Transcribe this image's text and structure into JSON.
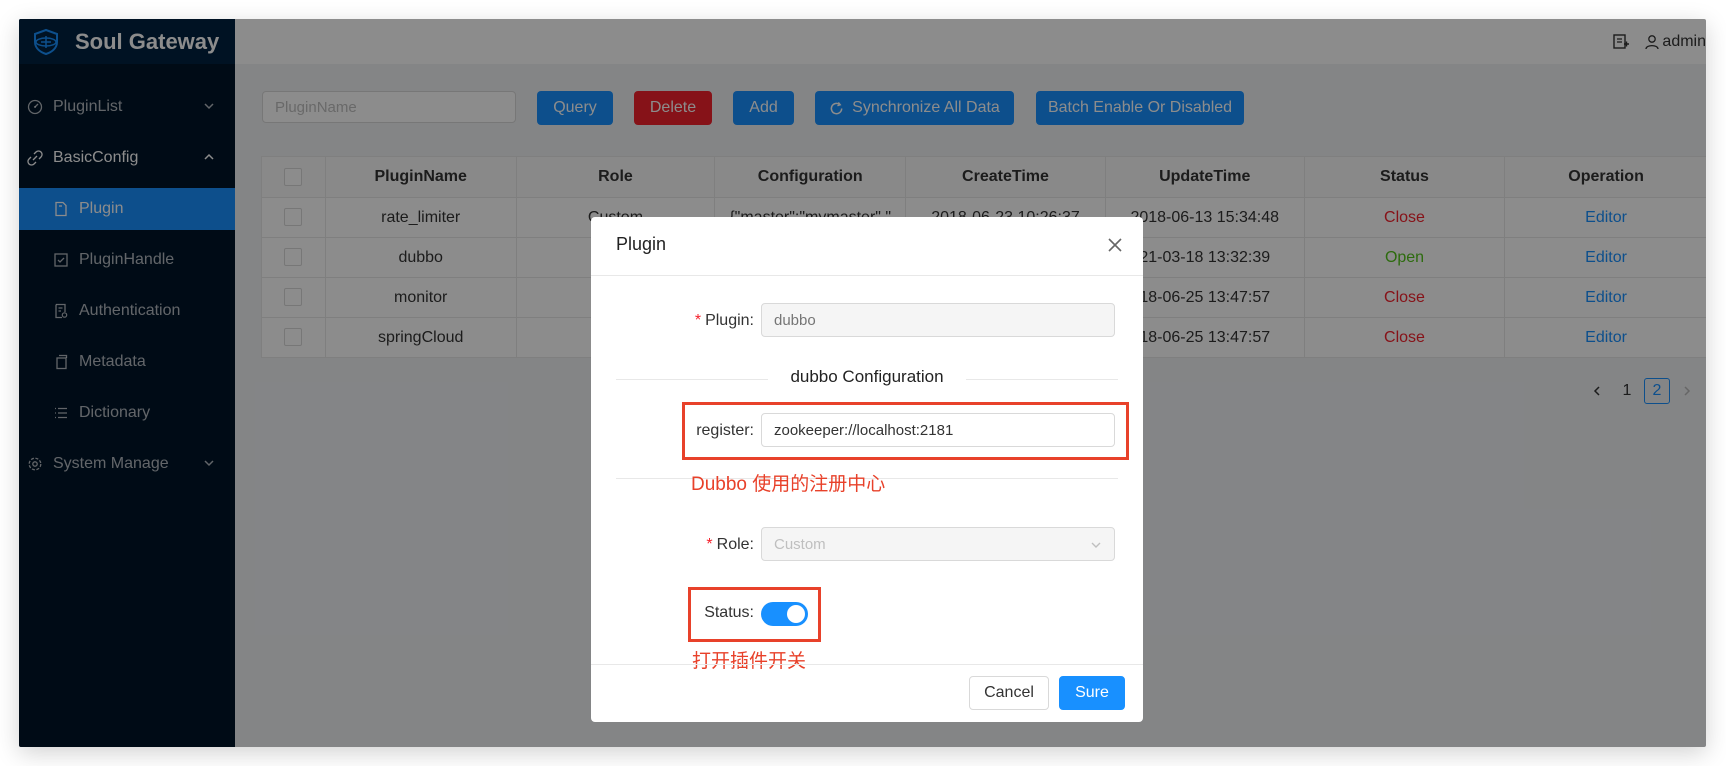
{
  "app": {
    "title": "Soul Gateway"
  },
  "header": {
    "user": "admin"
  },
  "sidebar": {
    "items": [
      {
        "label": "PluginList"
      },
      {
        "label": "BasicConfig"
      },
      {
        "label": "System Manage"
      }
    ],
    "sub_items": [
      {
        "label": "Plugin"
      },
      {
        "label": "PluginHandle"
      },
      {
        "label": "Authentication"
      },
      {
        "label": "Metadata"
      },
      {
        "label": "Dictionary"
      }
    ]
  },
  "toolbar": {
    "search_placeholder": "PluginName",
    "query": "Query",
    "delete": "Delete",
    "add": "Add",
    "sync": "Synchronize All Data",
    "batch": "Batch Enable Or Disabled"
  },
  "table": {
    "headers": [
      "PluginName",
      "Role",
      "Configuration",
      "CreateTime",
      "UpdateTime",
      "Status",
      "Operation"
    ],
    "rows": [
      {
        "name": "rate_limiter",
        "role": "Custom",
        "config": "{\"master\":\"mymaster\",\"",
        "create": "2018-06-23 10:26:37",
        "update": "2018-06-13 15:34:48",
        "status": "Close",
        "op": "Editor"
      },
      {
        "name": "dubbo",
        "role": "",
        "config": "",
        "create": "",
        "update": "21-03-18 13:32:39",
        "status": "Open",
        "op": "Editor"
      },
      {
        "name": "monitor",
        "role": "",
        "config": "",
        "create": "",
        "update": "18-06-25 13:47:57",
        "status": "Close",
        "op": "Editor"
      },
      {
        "name": "springCloud",
        "role": "",
        "config": "",
        "create": "",
        "update": "18-06-25 13:47:57",
        "status": "Close",
        "op": "Editor"
      }
    ]
  },
  "pagination": {
    "pages": [
      "1",
      "2"
    ],
    "current": "2"
  },
  "modal": {
    "title": "Plugin",
    "plugin_label": "Plugin",
    "plugin_value": "dubbo",
    "section_title": "dubbo Configuration",
    "register_label": "register",
    "register_value": "zookeeper://localhost:2181",
    "register_note": "Dubbo 使用的注册中心",
    "role_label": "Role",
    "role_value": "Custom",
    "status_label": "Status",
    "status_on": true,
    "status_note": "打开插件开关",
    "cancel": "Cancel",
    "ok": "Sure"
  },
  "colors": {
    "primary": "#1890ff",
    "danger": "#f5222d",
    "success": "#52c41a",
    "sidebar_bg": "#001529",
    "annotation": "#e8412a"
  }
}
